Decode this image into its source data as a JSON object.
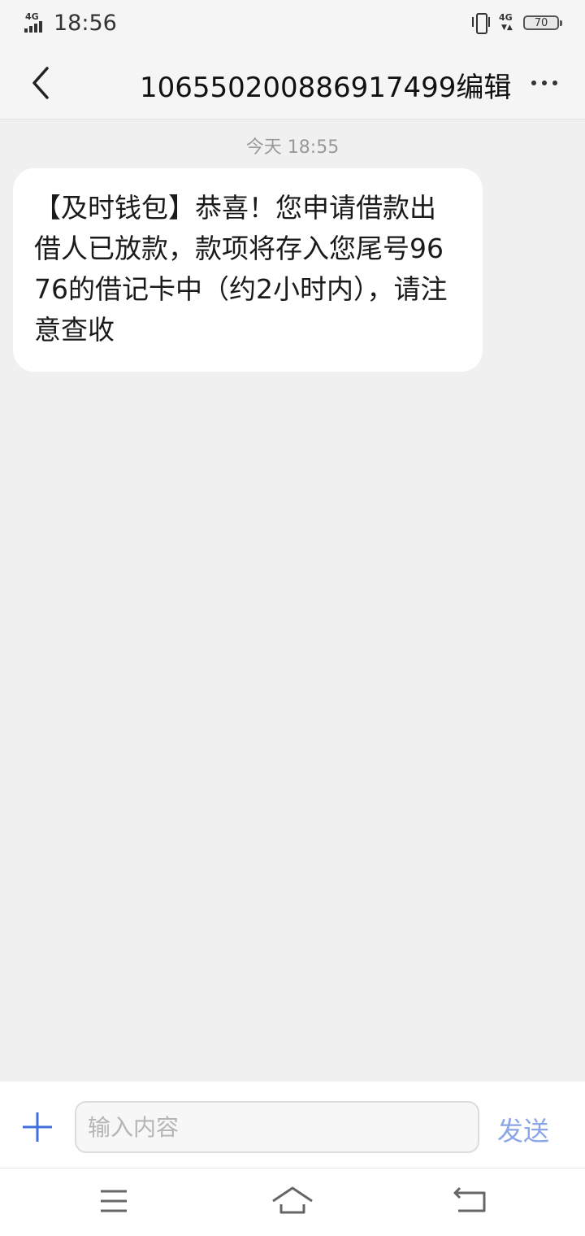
{
  "status_bar": {
    "signal_label": "4G",
    "time": "18:56",
    "network_label": "4G",
    "battery_level": "70"
  },
  "header": {
    "title": "10655020088691749​9编辑"
  },
  "conversation": {
    "timestamp": "今天 18:55",
    "messages": [
      {
        "text": "【及时钱包】恭喜！您申请借款出借人已放款，款项将存入您尾号9676的借记卡中（约2小时内），请注意查收"
      }
    ]
  },
  "composer": {
    "placeholder": "输入内容",
    "value": "",
    "send_label": "发送"
  },
  "icons": {
    "back": "chevron-left-icon",
    "more": "more-dots-icon",
    "add": "plus-icon",
    "nav_menu": "menu-icon",
    "nav_home": "home-icon",
    "nav_back": "back-icon"
  },
  "colors": {
    "accent": "#3f6fd8",
    "send_disabled": "#8aa6e6",
    "background": "#f0f0f0",
    "bubble": "#ffffff"
  }
}
